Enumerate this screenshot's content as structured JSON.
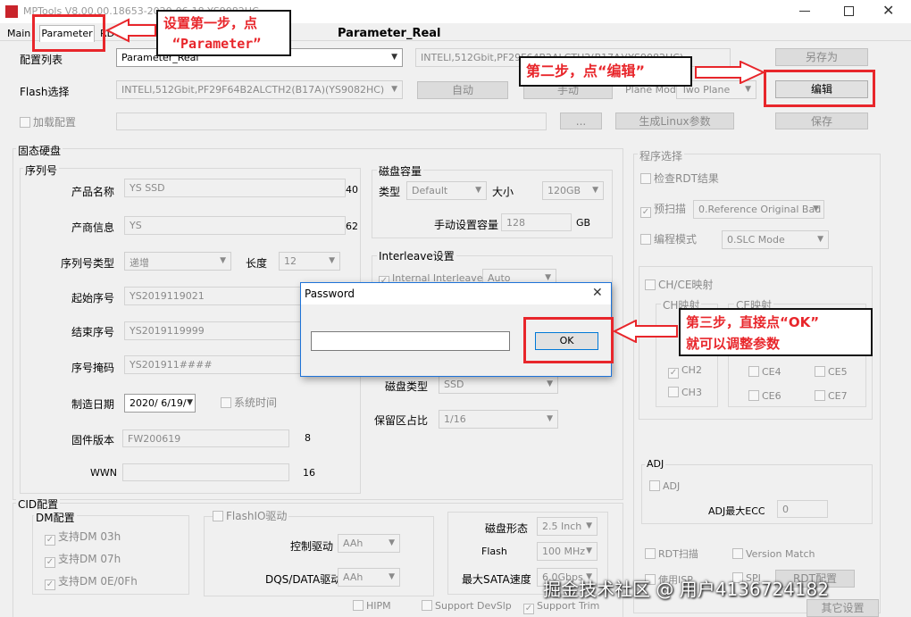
{
  "window": {
    "title": "MPTools V8.00.00.18653-2020-06-18  YS9082HC",
    "tabs": [
      {
        "label": "Main"
      },
      {
        "label": "Parameter"
      },
      {
        "label": "RDT Detail R"
      }
    ],
    "center_title": "Parameter_Real"
  },
  "top": {
    "config_list_label": "配置列表",
    "config_list_value": "Parameter_Real",
    "config_info": "INTELl,512Gbit,PF29F64B2ALCTH2(B17A)(YS9082HC)",
    "save_as_label": "另存为",
    "flash_select_label": "Flash选择",
    "flash_select_value": "INTELl,512Gbit,PF29F64B2ALCTH2(B17A)(YS9082HC)",
    "auto_label": "自动",
    "manual_label": "手动",
    "plane_mode_label": "Plane Mode",
    "plane_mode_value": "Two Plane",
    "edit_label": "编辑",
    "load_config_label": "加载配置",
    "browse_label": "...",
    "gen_linux_label": "生成Linux参数",
    "save_label": "保存"
  },
  "ssd": {
    "title": "固态硬盘",
    "serial_title": "序列号",
    "product_name_label": "产品名称",
    "product_name_value": "YS SSD",
    "product_name_len": "40",
    "vendor_label": "产商信息",
    "vendor_value": "YS",
    "vendor_len": "62",
    "sn_type_label": "序列号类型",
    "sn_type_value": "递增",
    "length_label": "长度",
    "length_value": "12",
    "start_sn_label": "起始序号",
    "start_sn_value": "YS2019119021",
    "end_sn_label": "结束序号",
    "end_sn_value": "YS2019119999",
    "sn_mask_label": "序号掩码",
    "sn_mask_value": "YS201911####",
    "mfg_date_label": "制造日期",
    "mfg_date_value": "2020/ 6/19/",
    "system_time_label": "系统时间",
    "fw_label": "固件版本",
    "fw_value": "FW200619",
    "fw_len": "8",
    "wwn_label": "WWN",
    "wwn_len": "16"
  },
  "capacity": {
    "title": "磁盘容量",
    "type_label": "类型",
    "type_value": "Default",
    "size_label": "大小",
    "size_value": "120GB",
    "manual_cap_label": "手动设置容量",
    "manual_cap_value": "128",
    "manual_cap_unit": "GB"
  },
  "interleave": {
    "title": "Interleave设置",
    "internal_label": "Internal Interleave",
    "internal_value": "Auto",
    "disk_type_label": "磁盘类型",
    "disk_type_value": "SSD",
    "reserve_label": "保留区占比",
    "reserve_value": "1/16"
  },
  "program": {
    "title": "程序选择",
    "check_rdt_label": "检查RDT结果",
    "prescan_label": "预扫描",
    "prescan_value": "0.Reference Original Bad",
    "prog_mode_label": "编程模式",
    "prog_mode_value": "0.SLC Mode",
    "chce_label": "CH/CE映射",
    "ch_map_label": "CH映射",
    "ce_map_label": "CE映射",
    "ch_items": [
      "CH2",
      "CH3"
    ],
    "ce_items": [
      "CE4",
      "CE5",
      "CE6",
      "CE7"
    ],
    "adj_title": "ADJ",
    "adj_label": "ADJ",
    "adj_ecc_label": "ADJ最大ECC",
    "adj_ecc_value": "0",
    "rdt_scan_label": "RDT扫描",
    "version_match_label": "Version Match",
    "use_isp_label": "使用ISP",
    "spi_label": "SPI",
    "rdt_config_label": "RDT配置",
    "other_settings_label": "其它设置"
  },
  "cid": {
    "title": "CID配置",
    "dm_title": "DM配置",
    "dm_items": [
      "支持DM 03h",
      "支持DM 07h",
      "支持DM 0E/0Fh"
    ],
    "flashio_label": "FlashIO驱动",
    "ctrl_drive_label": "控制驱动",
    "ctrl_drive_value": "AAh",
    "dqs_label": "DQS/DATA驱动",
    "dqs_value": "AAh",
    "form_label": "磁盘形态",
    "form_value": "2.5 Inch",
    "flash_label": "Flash",
    "flash_value": "100 MHz",
    "sata_label": "最大SATA速度",
    "sata_value": "6.0Gbps",
    "hipm_label": "HIPM",
    "devslp_label": "Support DevSlp",
    "trim_label": "Support Trim"
  },
  "dialog": {
    "title": "Password",
    "ok_label": "OK",
    "password_value": ""
  },
  "annotations": {
    "step1_line1": "设置第一步，点",
    "step1_line2": "“Parameter”",
    "step2": "第二步，点“编辑”",
    "step3_line1": "第三步，直接点“OK”",
    "step3_line2": "就可以调整参数",
    "red_color": "#e8262b"
  },
  "watermark": "掘金技术社区 @ 用户4136724182"
}
